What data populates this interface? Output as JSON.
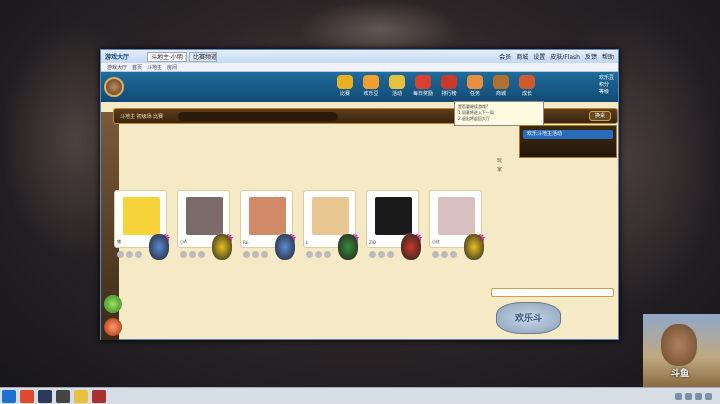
{
  "window": {
    "app_title": "游戏大厅",
    "tab1": "斗地主·小明 之...",
    "tab2": "比赛频道",
    "menu": [
      "会员",
      "商城",
      "设置",
      "皮肤/Flash",
      "反馈",
      "帮助"
    ],
    "nav": [
      "游戏大厅",
      "首页",
      "斗地主",
      "房间"
    ]
  },
  "game_toolbar": {
    "icons": [
      {
        "label": "比赛",
        "color": "#e8b020"
      },
      {
        "label": "欢乐豆",
        "color": "#f0a030"
      },
      {
        "label": "活动",
        "color": "#e8c040"
      },
      {
        "label": "每日奖励",
        "color": "#d84030"
      },
      {
        "label": "排行榜",
        "color": "#c83a2a"
      },
      {
        "label": "任务",
        "color": "#e89040"
      },
      {
        "label": "商城",
        "color": "#b07030"
      },
      {
        "label": "成长",
        "color": "#d05a30"
      }
    ],
    "user_lines": [
      "欢乐豆",
      "积分",
      "等级"
    ]
  },
  "room": {
    "info": "斗地主 初级场 比赛",
    "button": "换桌"
  },
  "tooltip": {
    "lines": [
      "是否要继续游戏?",
      "1.同意将进入下一局",
      "2.退出将返回大厅"
    ]
  },
  "right_panel": {
    "row": "欢乐斗地主活动"
  },
  "panel_text": [
    "玩",
    "家"
  ],
  "players": [
    {
      "name": "猪",
      "ready": "准备",
      "photo": "#f7d43a",
      "mascot": "#5a8ad8"
    },
    {
      "name": "小A",
      "ready": "准备",
      "photo": "#7a6a6a",
      "mascot": "#e8c020"
    },
    {
      "name": "Fai",
      "ready": "准备",
      "photo": "#d08a6a",
      "mascot": "#5a8ad8"
    },
    {
      "name": "L",
      "ready": "准备",
      "photo": "#e8c890",
      "mascot": "#3a8a3a"
    },
    {
      "name": "ZiO",
      "ready": "准备",
      "photo": "#1a1a1a",
      "mascot": "#c83a2a"
    },
    {
      "name": "小红",
      "ready": "准备",
      "photo": "#d8c0c0",
      "mascot": "#e8c020"
    }
  ],
  "logo": "欢乐斗",
  "webcam": {
    "mark": "斗鱼"
  },
  "taskbar": {
    "icons": [
      "#1d6fd0",
      "#e04a2a",
      "#2a3a5a",
      "#444444",
      "#e8c040",
      "#aa3030"
    ]
  }
}
